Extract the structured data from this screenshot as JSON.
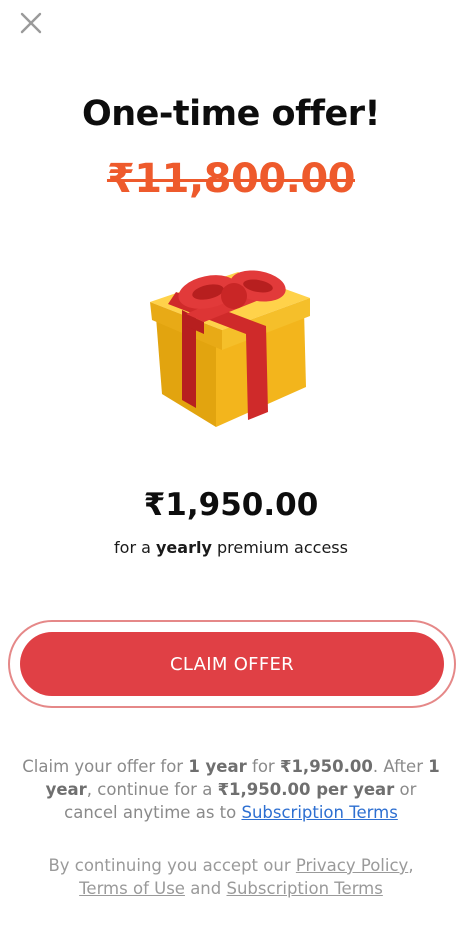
{
  "header": {
    "close_icon": "close-icon"
  },
  "offer": {
    "title": "One-time offer!",
    "old_price": "₹11,800.00",
    "gift_icon": "gift-box-icon",
    "price": "₹1,950.00",
    "subtitle": {
      "prefix": "for a ",
      "highlight": "yearly",
      "suffix": " premium access"
    }
  },
  "cta": {
    "label": "CLAIM OFFER"
  },
  "terms": {
    "p1": "Claim your offer for ",
    "b1": "1 year",
    "p2": " for ",
    "b2": "₹1,950.00",
    "p3": ". After ",
    "b3": "1 year",
    "p4": ", continue for a ",
    "b4": "₹1,950.00 per year",
    "p5": " or cancel anytime as to ",
    "link": "Subscription Terms"
  },
  "legal": {
    "p1": "By continuing you accept our ",
    "privacy_link": "Privacy Policy",
    "p2": ",",
    "tou_link": "Terms of Use",
    "p3": " and ",
    "sub_link": "Subscription Terms"
  },
  "colors": {
    "accent": "#e04045",
    "old_price": "#ee5a2c",
    "link": "#2d6fd1"
  }
}
